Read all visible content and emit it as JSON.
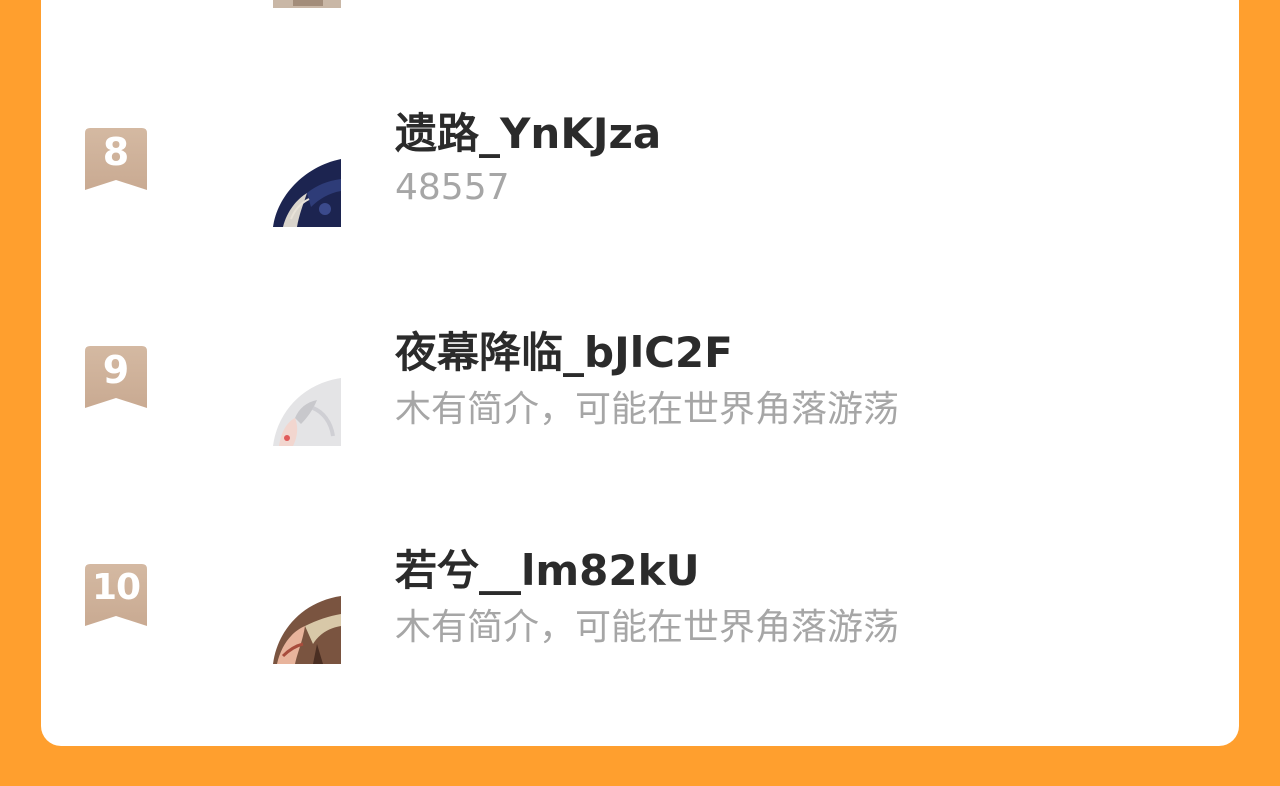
{
  "leaderboard": {
    "entries": [
      {
        "rank": "8",
        "name": "遗路_YnKJza",
        "description": "48557",
        "avatar": "avatar-dark-blue-anime"
      },
      {
        "rank": "9",
        "name": "夜幕降临_bJlC2F",
        "description": "木有简介，可能在世界角落游荡",
        "avatar": "avatar-light-anime"
      },
      {
        "rank": "10",
        "name": "若兮__lm82kU",
        "description": "木有简介，可能在世界角落游荡",
        "avatar": "avatar-warm-anime"
      }
    ]
  },
  "colors": {
    "background": "#FF9F2E",
    "card": "#FFFFFF",
    "rank_ribbon_top": "#D4B9A2",
    "rank_ribbon_bottom": "#C9AA92",
    "name_text": "#2B2B2B",
    "description_text": "#A6A6A6"
  }
}
